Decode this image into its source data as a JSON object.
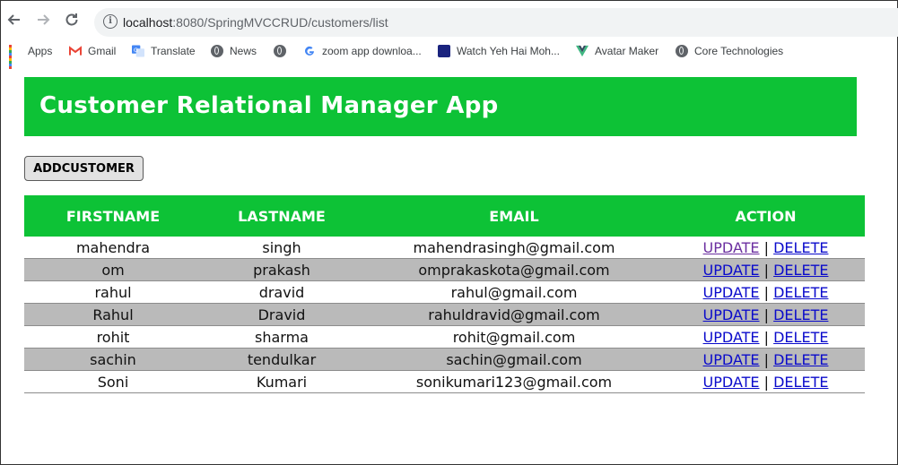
{
  "browser": {
    "url_host": "localhost",
    "url_rest": ":8080/SpringMVCCRUD/customers/list",
    "bookmarks": [
      {
        "label": "Apps",
        "icon": "apps-grid-icon"
      },
      {
        "label": "Gmail",
        "icon": "gmail-icon"
      },
      {
        "label": "Translate",
        "icon": "translate-icon"
      },
      {
        "label": "News",
        "icon": "globe-icon"
      },
      {
        "label": "",
        "icon": "globe-icon"
      },
      {
        "label": "zoom app downloa...",
        "icon": "google-icon"
      },
      {
        "label": "Watch Yeh Hai Moh...",
        "icon": "site-icon"
      },
      {
        "label": "Avatar Maker",
        "icon": "vue-icon"
      },
      {
        "label": "Core Technologies",
        "icon": "globe-icon"
      }
    ]
  },
  "page": {
    "title": "Customer Relational Manager App",
    "add_button": "ADDCUSTOMER",
    "accent_color": "#0dc236"
  },
  "table": {
    "headers": [
      "FIRSTNAME",
      "LASTNAME",
      "EMAIL",
      "ACTION"
    ],
    "update_label": "UPDATE",
    "delete_label": "DELETE",
    "separator": "|",
    "rows": [
      {
        "first": "mahendra",
        "last": "singh",
        "email": "mahendrasingh@gmail.com"
      },
      {
        "first": "om",
        "last": "prakash",
        "email": "omprakaskota@gmail.com"
      },
      {
        "first": "rahul",
        "last": "dravid",
        "email": "rahul@gmail.com"
      },
      {
        "first": "Rahul",
        "last": "Dravid",
        "email": "rahuldravid@gmail.com"
      },
      {
        "first": "rohit",
        "last": "sharma",
        "email": "rohit@gmail.com"
      },
      {
        "first": "sachin",
        "last": "tendulkar",
        "email": "sachin@gmail.com"
      },
      {
        "first": "Soni",
        "last": "Kumari",
        "email": "sonikumari123@gmail.com"
      }
    ]
  }
}
